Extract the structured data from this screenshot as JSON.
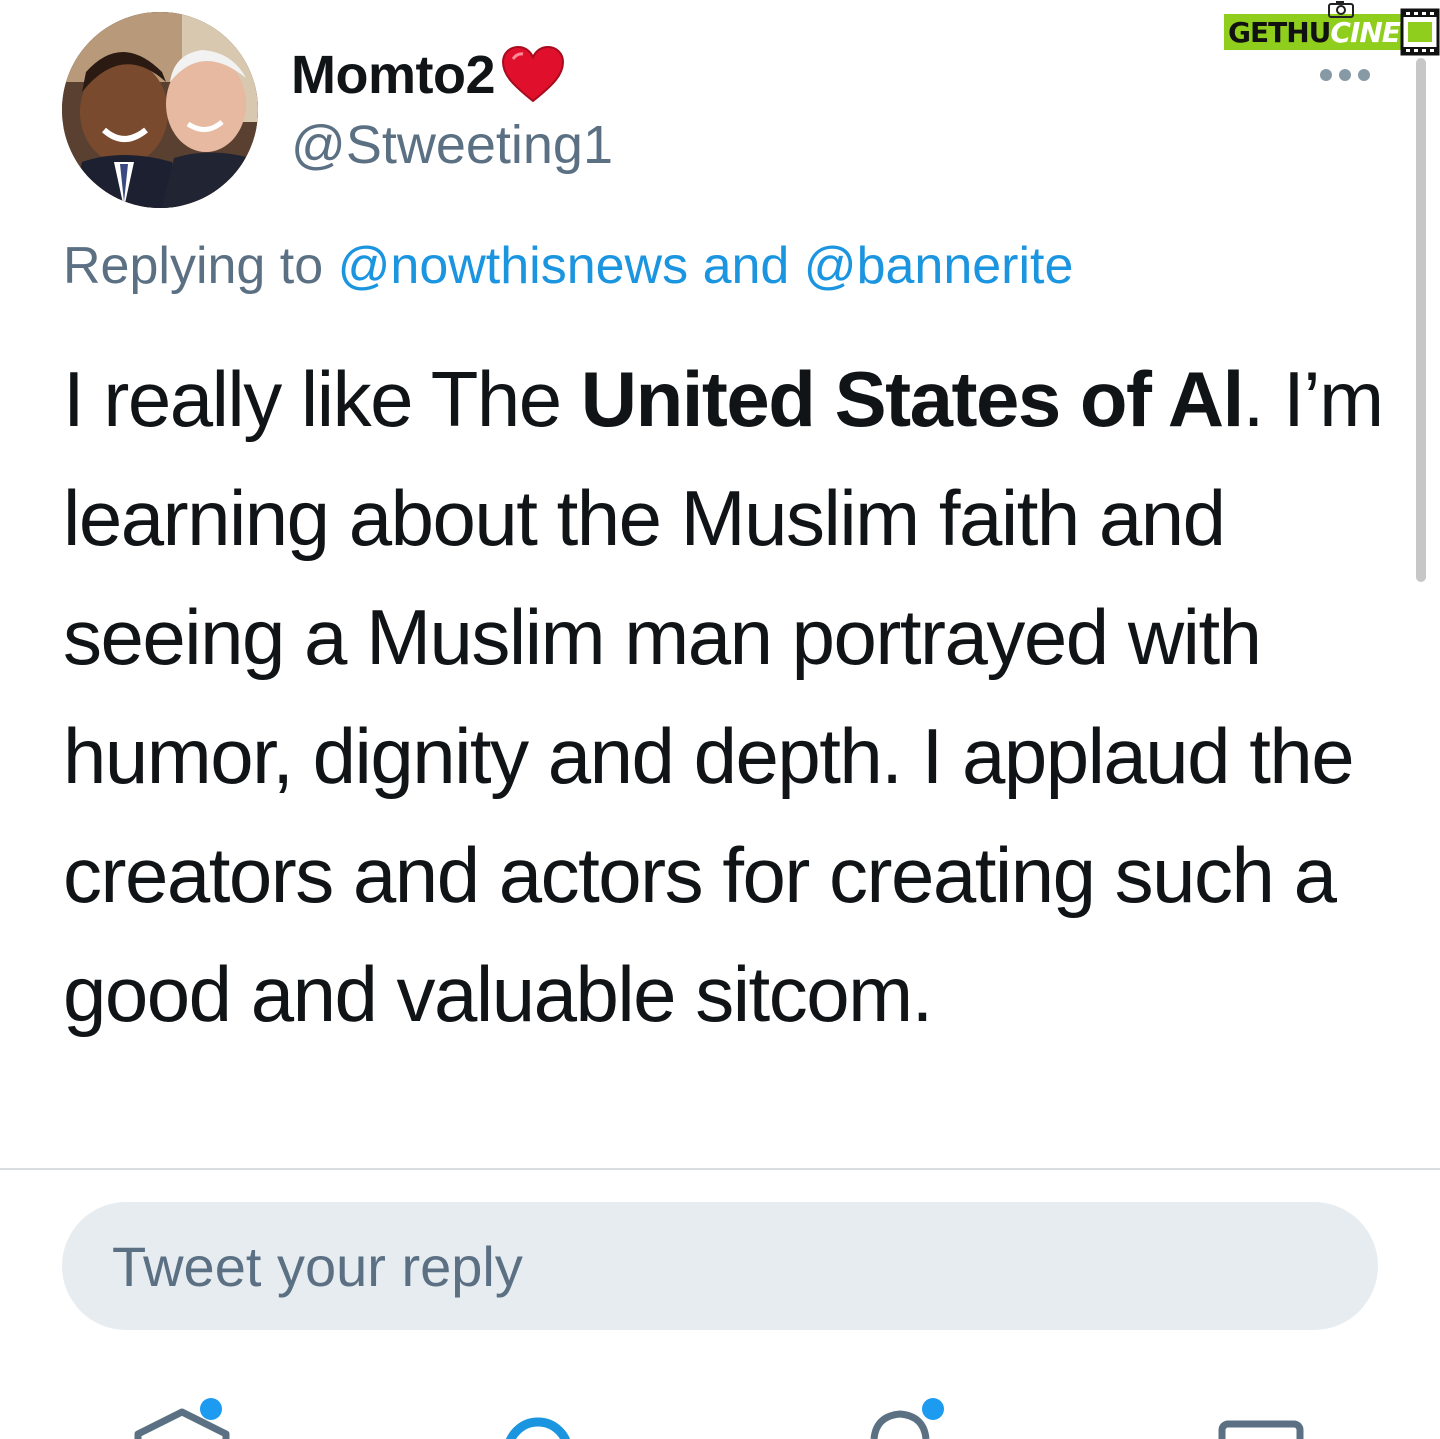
{
  "tweet": {
    "display_name": "Momto2",
    "handle": "@Stweeting1",
    "replying_prefix": "Replying to",
    "replying_to": [
      "@nowthisnews",
      "@bannerite"
    ],
    "replying_joiner": "and",
    "text_before": "I really like The ",
    "text_bold": "United States of Al",
    "text_after": ". I’m learning about the Muslim faith and seeing a Muslim man portrayed with humor, dignity and depth. I applaud the creators and actors for creating such a good and valuable sitcom."
  },
  "reply": {
    "placeholder": "Tweet your reply"
  },
  "watermark": {
    "part1": "GETHU",
    "part2": "CINEMA"
  },
  "icons": {
    "heart": "red-heart-emoji",
    "more": "more-options-icon",
    "nav": [
      "home-icon",
      "search-icon",
      "notifications-icon",
      "messages-icon"
    ]
  },
  "colors": {
    "accent": "#1b95e0",
    "secondary_text": "#5b7083",
    "reply_box_bg": "#e7ecf0",
    "watermark_green": "#8fce1d"
  }
}
